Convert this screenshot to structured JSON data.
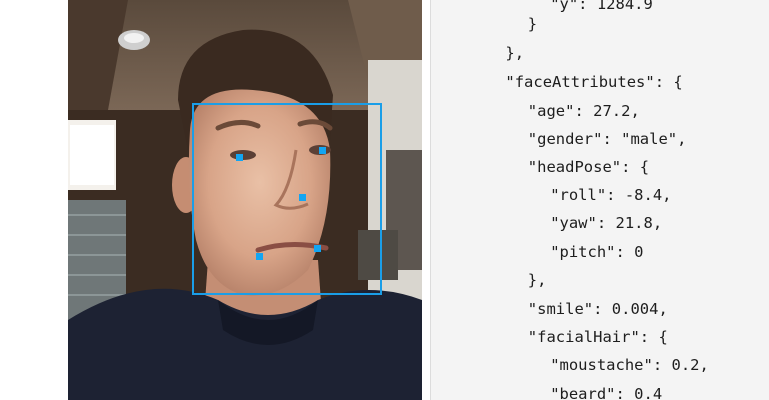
{
  "code_lines": [
    "      \"y\": 1284.9",
    "    }",
    "  },",
    "  \"faceAttributes\": {",
    "    \"age\": 27.2,",
    "    \"gender\": \"male\",",
    "    \"headPose\": {",
    "      \"roll\": -8.4,",
    "      \"yaw\": 21.8,",
    "      \"pitch\": 0",
    "    },",
    "    \"smile\": 0.004,",
    "    \"facialHair\": {",
    "      \"moustache\": 0.2,",
    "      \"beard\": 0.4"
  ],
  "colors": {
    "face_box": "#1a9ee8",
    "landmark": "#13a5f2",
    "code_background": "#f4f4f4"
  }
}
